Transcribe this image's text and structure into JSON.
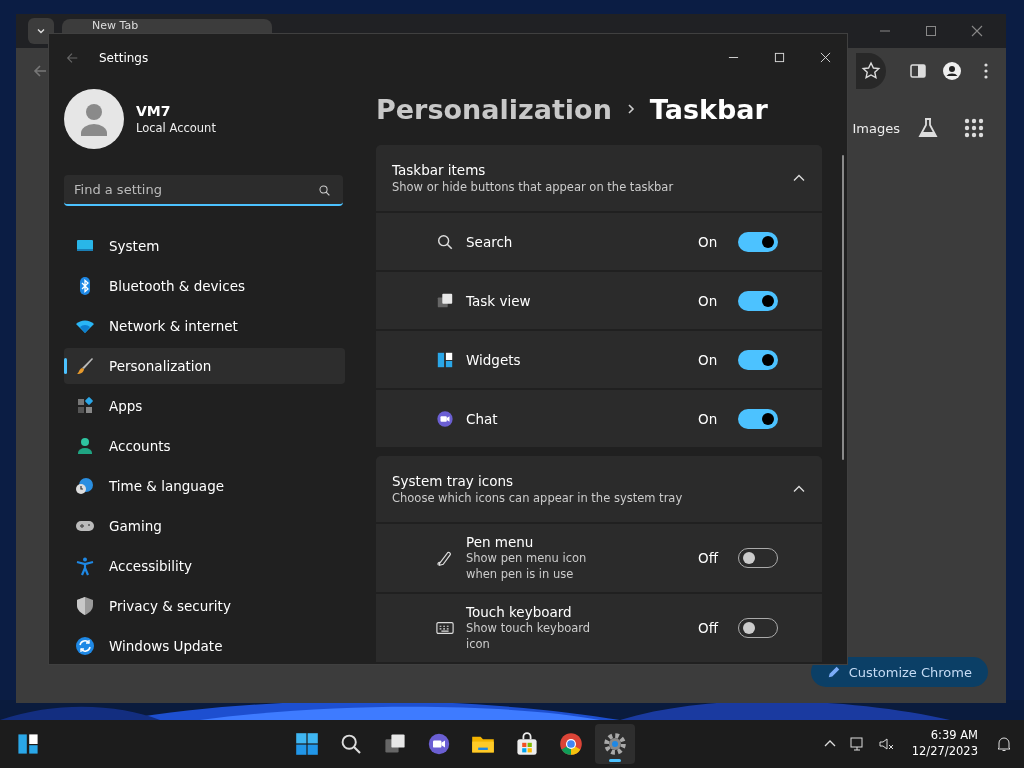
{
  "browser": {
    "tab_title": "New Tab",
    "page_links": [
      "Images"
    ],
    "customize_button": "Customize Chrome"
  },
  "settings": {
    "title": "Settings",
    "user": {
      "name": "VM7",
      "account": "Local Account"
    },
    "search": {
      "placeholder": "Find a setting"
    },
    "nav": [
      {
        "label": "System",
        "selected": false
      },
      {
        "label": "Bluetooth & devices",
        "selected": false
      },
      {
        "label": "Network & internet",
        "selected": false
      },
      {
        "label": "Personalization",
        "selected": true
      },
      {
        "label": "Apps",
        "selected": false
      },
      {
        "label": "Accounts",
        "selected": false
      },
      {
        "label": "Time & language",
        "selected": false
      },
      {
        "label": "Gaming",
        "selected": false
      },
      {
        "label": "Accessibility",
        "selected": false
      },
      {
        "label": "Privacy & security",
        "selected": false
      },
      {
        "label": "Windows Update",
        "selected": false
      }
    ],
    "breadcrumb": {
      "parent": "Personalization",
      "current": "Taskbar"
    },
    "sections": [
      {
        "title": "Taskbar items",
        "subtitle": "Show or hide buttons that appear on the taskbar",
        "expanded": true,
        "items": [
          {
            "label": "Search",
            "state_label": "On",
            "on": true
          },
          {
            "label": "Task view",
            "state_label": "On",
            "on": true
          },
          {
            "label": "Widgets",
            "state_label": "On",
            "on": true
          },
          {
            "label": "Chat",
            "state_label": "On",
            "on": true
          }
        ]
      },
      {
        "title": "System tray icons",
        "subtitle": "Choose which icons can appear in the system tray",
        "expanded": true,
        "items": [
          {
            "label": "Pen menu",
            "description": "Show pen menu icon when pen is in use",
            "state_label": "Off",
            "on": false
          },
          {
            "label": "Touch keyboard",
            "description": "Show touch keyboard icon",
            "state_label": "Off",
            "on": false
          }
        ]
      }
    ]
  },
  "taskbar": {
    "apps": [
      {
        "active": false
      },
      {
        "active": false
      },
      {
        "active": false
      },
      {
        "active": false
      },
      {
        "active": false
      },
      {
        "active": false
      },
      {
        "active": false
      },
      {
        "active": true
      }
    ],
    "time": "6:39 AM",
    "date": "12/27/2023"
  }
}
